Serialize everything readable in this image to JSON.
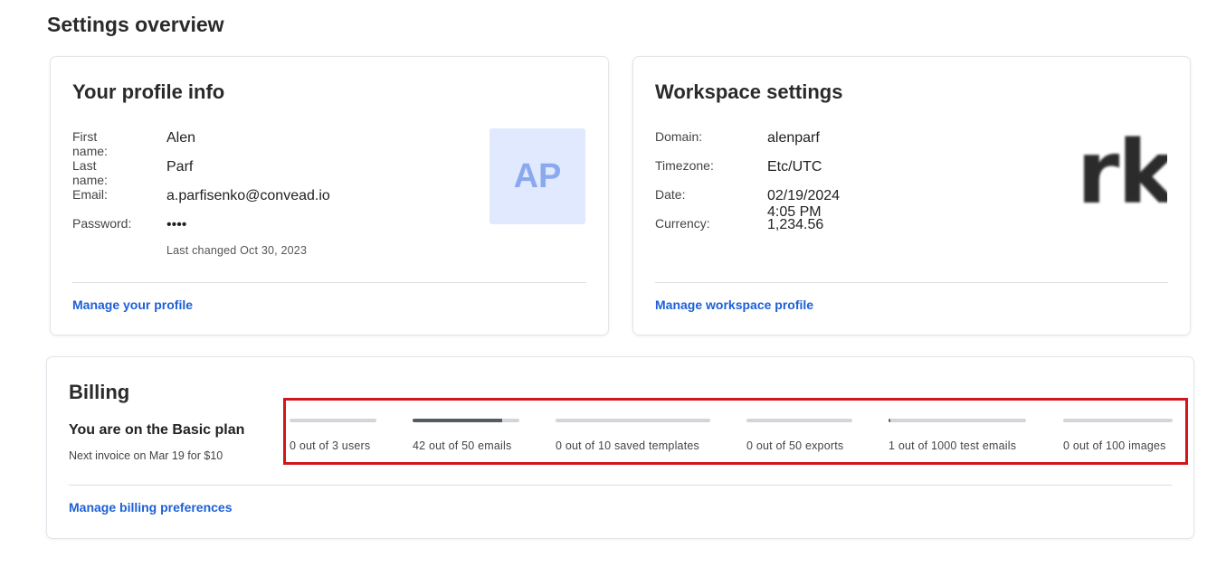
{
  "page": {
    "title": "Settings overview"
  },
  "profile": {
    "title": "Your profile info",
    "fields": [
      {
        "label": "First name:",
        "value": "Alen"
      },
      {
        "label": "Last name:",
        "value": "Parf"
      },
      {
        "label": "Email:",
        "value": "a.parfisenko@convead.io"
      },
      {
        "label": "Password:",
        "value": "••••"
      }
    ],
    "last_changed": "Last changed Oct 30, 2023",
    "avatar_initials": "AP",
    "manage_link": "Manage your profile"
  },
  "workspace": {
    "title": "Workspace settings",
    "fields": [
      {
        "label": "Domain:",
        "value": "alenparf"
      },
      {
        "label": "Timezone:",
        "value": "Etc/UTC"
      },
      {
        "label": "Date:",
        "value": "02/19/2024 4:05 PM"
      },
      {
        "label": "Currency:",
        "value": "1,234.56"
      }
    ],
    "logo_text": "rk",
    "manage_link": "Manage workspace profile"
  },
  "billing": {
    "title": "Billing",
    "plan": "You are on the Basic plan",
    "next_invoice": "Next invoice on Mar 19 for $10",
    "usage": [
      {
        "caption": "0 out of 3 users",
        "used": 0,
        "limit": 3
      },
      {
        "caption": "42 out of 50 emails",
        "used": 42,
        "limit": 50
      },
      {
        "caption": "0 out of 10 saved templates",
        "used": 0,
        "limit": 10
      },
      {
        "caption": "0 out of 50 exports",
        "used": 0,
        "limit": 50
      },
      {
        "caption": "1 out of 1000 test emails",
        "used": 1,
        "limit": 1000
      },
      {
        "caption": "0 out of 100 images",
        "used": 0,
        "limit": 100
      }
    ],
    "manage_link": "Manage billing preferences"
  },
  "colors": {
    "link": "#1d5fd6",
    "highlight_border": "#d2161b",
    "meter_fill": "#555b63",
    "meter_track": "#d3d5da",
    "avatar_bg": "#e0e9fd",
    "avatar_text": "#8aa9ee"
  }
}
